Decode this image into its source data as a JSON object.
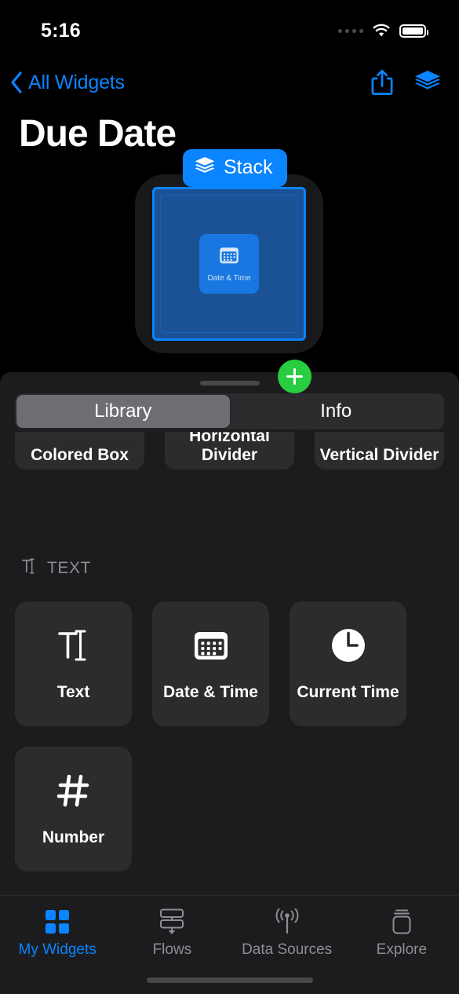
{
  "status_bar": {
    "time": "5:16",
    "cellular_icon": "cellular-dots-icon",
    "wifi_icon": "wifi-icon",
    "battery_icon": "battery-full-icon"
  },
  "nav_bar": {
    "back_label": "All Widgets",
    "back_icon": "chevron-left-icon",
    "share_icon": "share-icon",
    "layers_icon": "layers-icon"
  },
  "header": {
    "title": "Due Date"
  },
  "preview": {
    "stack_badge": {
      "label": "Stack",
      "icon": "layers-icon"
    },
    "add_button": {
      "icon": "plus-icon"
    },
    "element": {
      "label": "Date & Time",
      "icon": "calendar-icon"
    }
  },
  "sheet": {
    "grabber": "drag-handle",
    "segments": [
      {
        "label": "Library",
        "selected": true
      },
      {
        "label": "Info",
        "selected": false
      }
    ],
    "partial_row": [
      {
        "label": "Colored Box"
      },
      {
        "label": "Horizontal Divider"
      },
      {
        "label": "Vertical Divider"
      }
    ],
    "section": {
      "label": "TEXT",
      "icon": "text-cursor-icon"
    },
    "items": [
      {
        "label": "Text",
        "icon": "text-cursor-icon"
      },
      {
        "label": "Date & Time",
        "icon": "calendar-icon"
      },
      {
        "label": "Current Time",
        "icon": "clock-icon"
      },
      {
        "label": "Number",
        "icon": "hash-icon"
      }
    ]
  },
  "tab_bar": {
    "tabs": [
      {
        "label": "My Widgets",
        "icon": "grid-squares-icon",
        "active": true
      },
      {
        "label": "Flows",
        "icon": "flow-icon",
        "active": false
      },
      {
        "label": "Data Sources",
        "icon": "broadcast-icon",
        "active": false
      },
      {
        "label": "Explore",
        "icon": "jar-icon",
        "active": false
      }
    ]
  },
  "colors": {
    "accent": "#0a84ff",
    "green": "#28cd41",
    "background": "#000000",
    "sheet": "#1c1c1e",
    "card": "#2c2c2e",
    "secondary_text": "#8e8e93",
    "widget_fill": "#1b5296"
  }
}
